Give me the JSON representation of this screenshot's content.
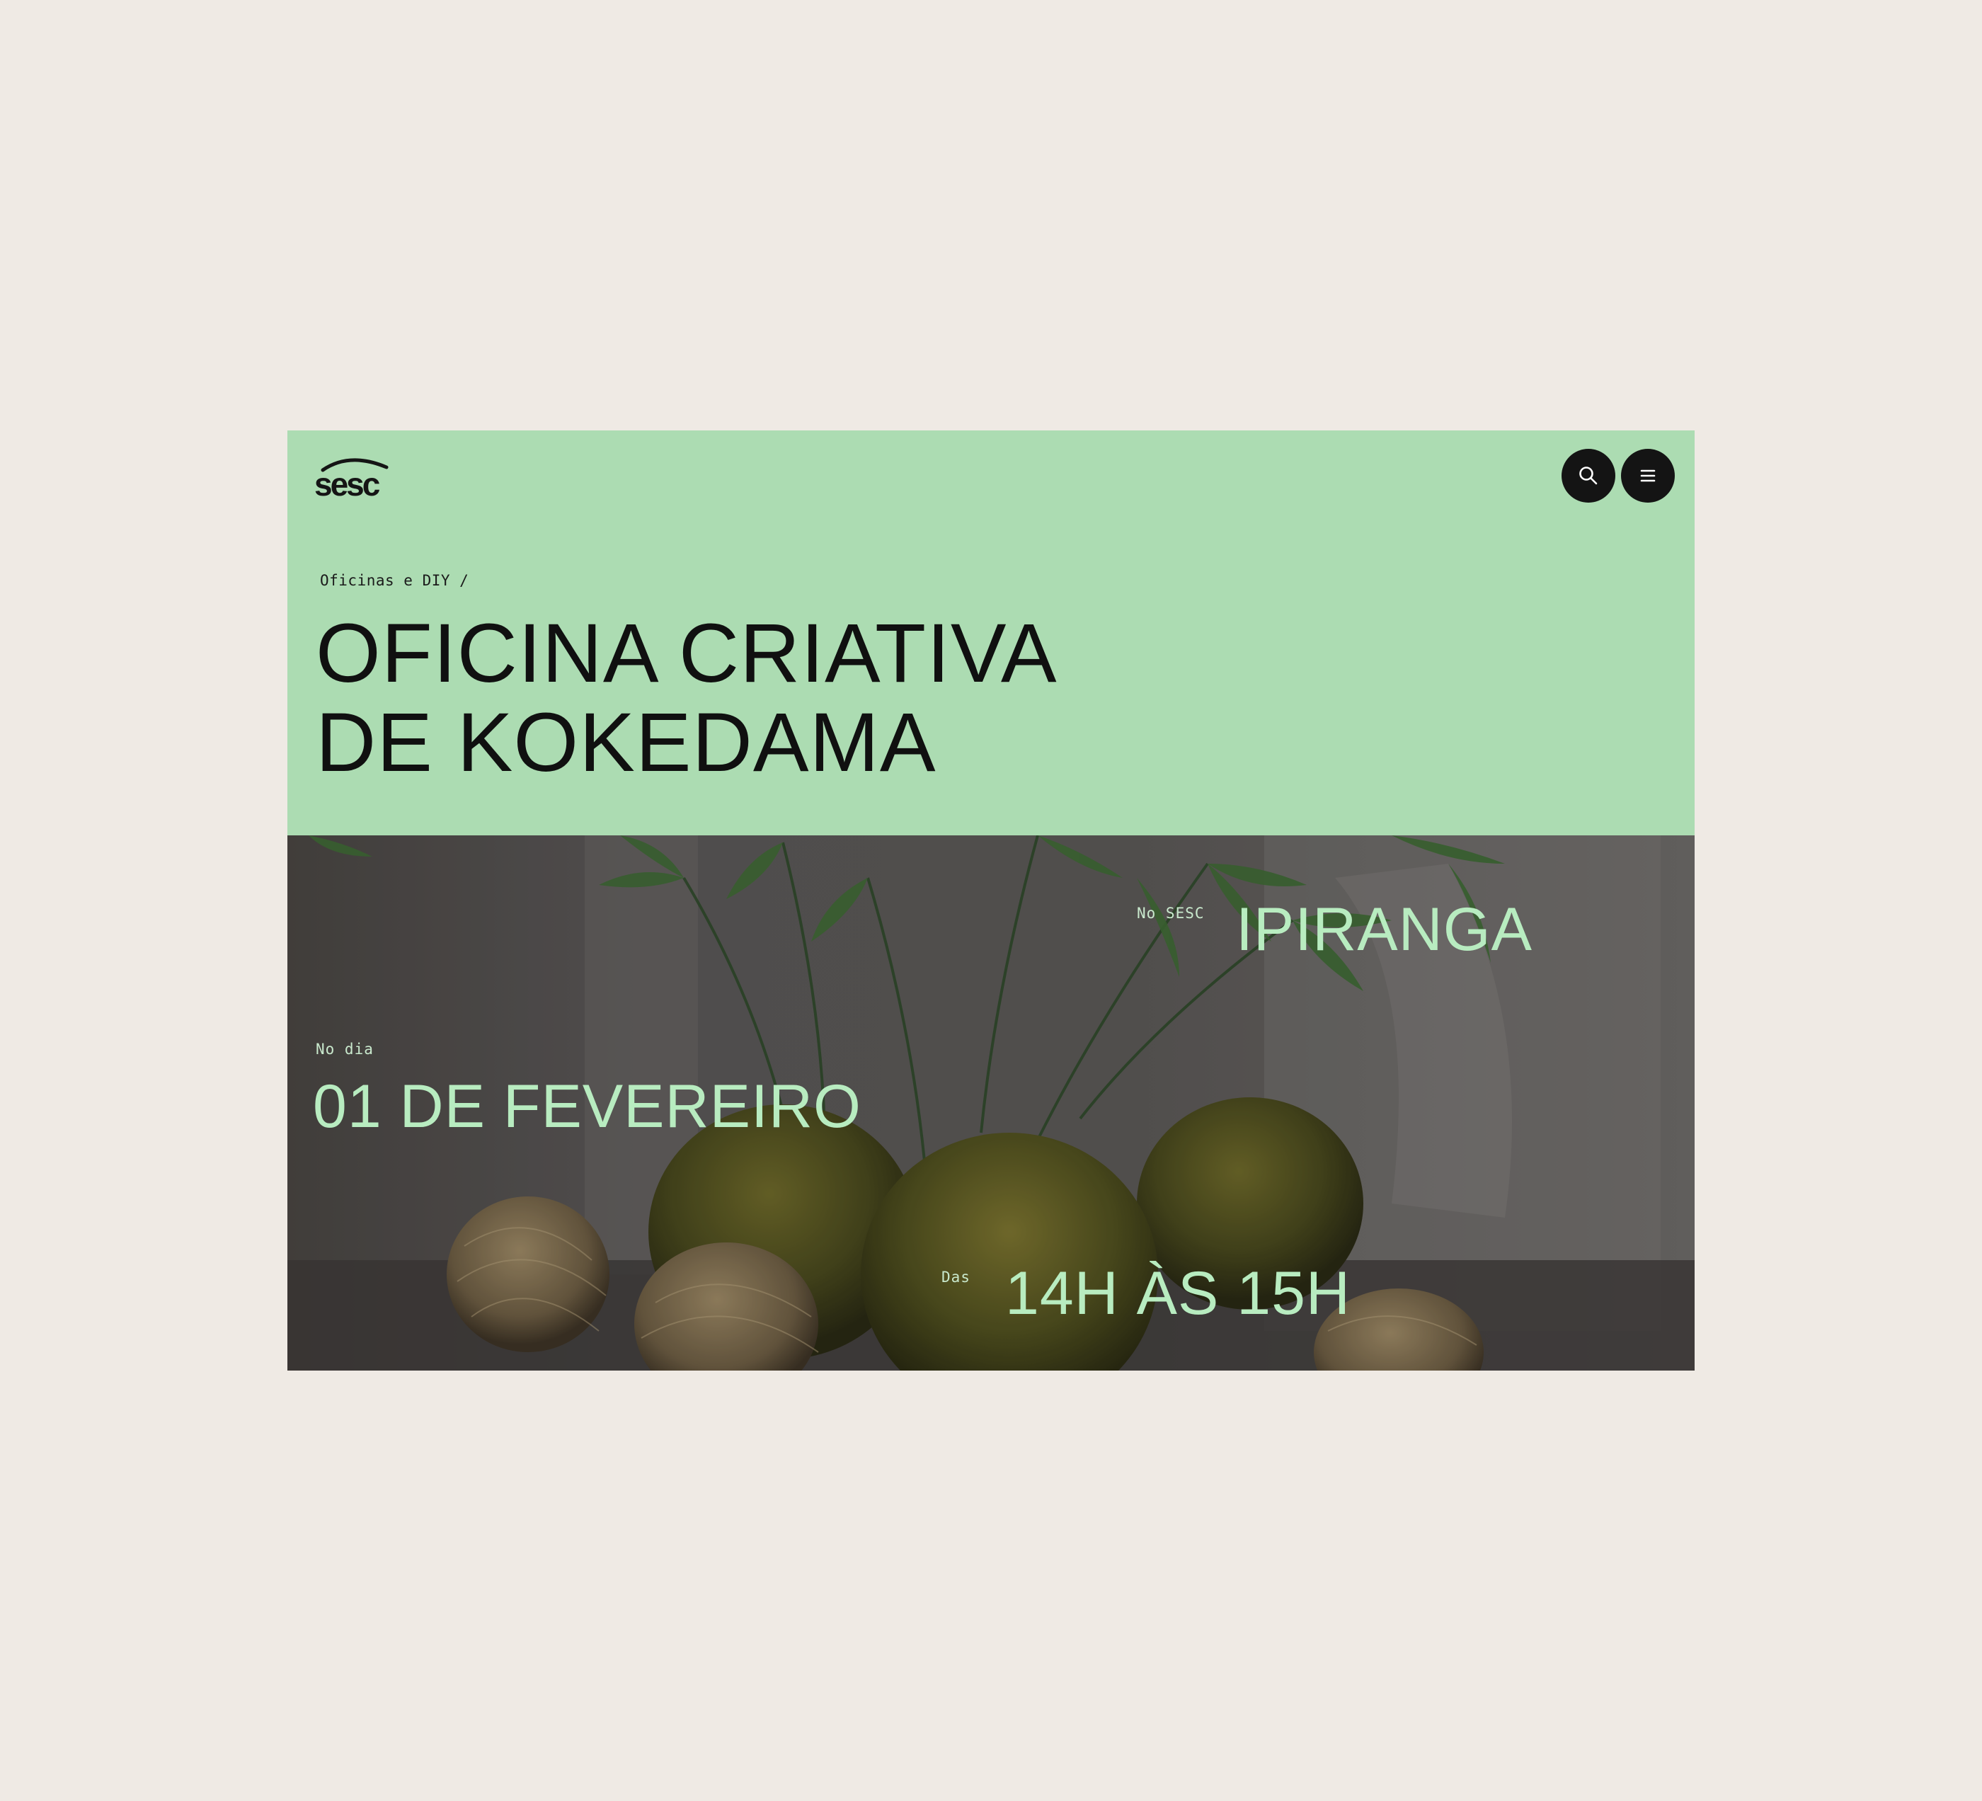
{
  "header": {
    "logo_text": "sesc",
    "breadcrumb": "Oficinas e DIY /",
    "title_lines": [
      "OFICINA CRIATIVA",
      "DE KOKEDAMA"
    ]
  },
  "toolbar": {
    "search_icon": "search-icon",
    "menu_icon": "menu-icon"
  },
  "event": {
    "venue_label": "No SESC",
    "venue": "IPIRANGA",
    "date_label": "No dia",
    "date": "01 DE FEVEREIRO",
    "time_label": "Das",
    "time": "14H ÀS 15H"
  },
  "colors": {
    "page_background": "#efeae4",
    "header_background": "#acdcb2",
    "icon_button": "#141414",
    "accent_text": "#b8ecc0"
  }
}
